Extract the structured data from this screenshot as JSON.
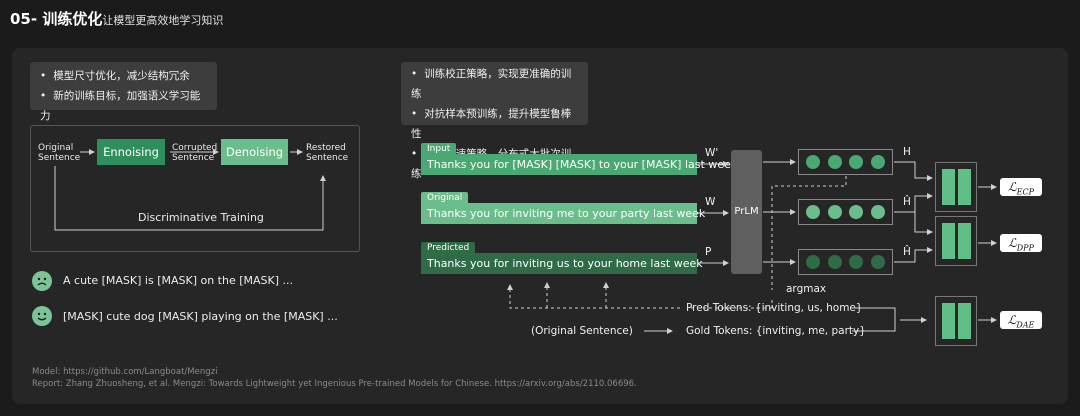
{
  "header": {
    "title": "05- 训练优化",
    "subtitle": "让模型更高效地学习知识"
  },
  "left": {
    "bullets": [
      "模型尺寸优化，减少结构冗余",
      "新的训练目标，加强语义学习能力"
    ],
    "diagram": {
      "original": "Original\nSentence",
      "ennoising": "Ennoising",
      "corrupted": "Corrupted\nSentence",
      "denoising": "Denoising",
      "restored": "Restored\nSentence",
      "discriminative": "Discriminative Training"
    },
    "sentences": [
      "A cute [MASK] is [MASK] on the [MASK] ...",
      "[MASK] cute dog [MASK] playing on the [MASK] ..."
    ]
  },
  "right": {
    "bullets": [
      "训练校正策略，实现更准确的训练",
      "对抗样本预训练，提升模型鲁棒性",
      "训练加速策略，分布式大批次训练"
    ],
    "rows": [
      {
        "tag": "Input",
        "text": "Thanks you for [MASK] [MASK] to your [MASK] last week",
        "sym": "W'",
        "out": "H",
        "color": "#4aa872"
      },
      {
        "tag": "Original",
        "text": "Thanks you for inviting me to your party last week",
        "sym": "W",
        "out": "Ĥ",
        "color": "#6bbd8b"
      },
      {
        "tag": "Predicted",
        "text": "Thanks you for inviting us to your home last week",
        "sym": "P",
        "out": "Ĥ",
        "color": "#2e6b46"
      }
    ],
    "prlm": "PrLM",
    "argmax": "argmax",
    "pred_tokens": "Pred Tokens: {inviting, us, home}",
    "gold_tokens": "Gold Tokens: {inviting, me, party}",
    "orig_sentence": "(Original Sentence)",
    "losses": [
      {
        "base": "ℒ",
        "sub": "ECP"
      },
      {
        "base": "ℒ",
        "sub": "DPP"
      },
      {
        "base": "ℒ",
        "sub": "DAE"
      }
    ]
  },
  "footer": {
    "model": "Model:   https://github.com/Langboat/Mengzi",
    "report": "Report: Zhang Zhuosheng, et al. Mengzi: Towards Lightweight yet Ingenious Pre-trained Models for Chinese. https://arxiv.org/abs/2110.06696."
  }
}
